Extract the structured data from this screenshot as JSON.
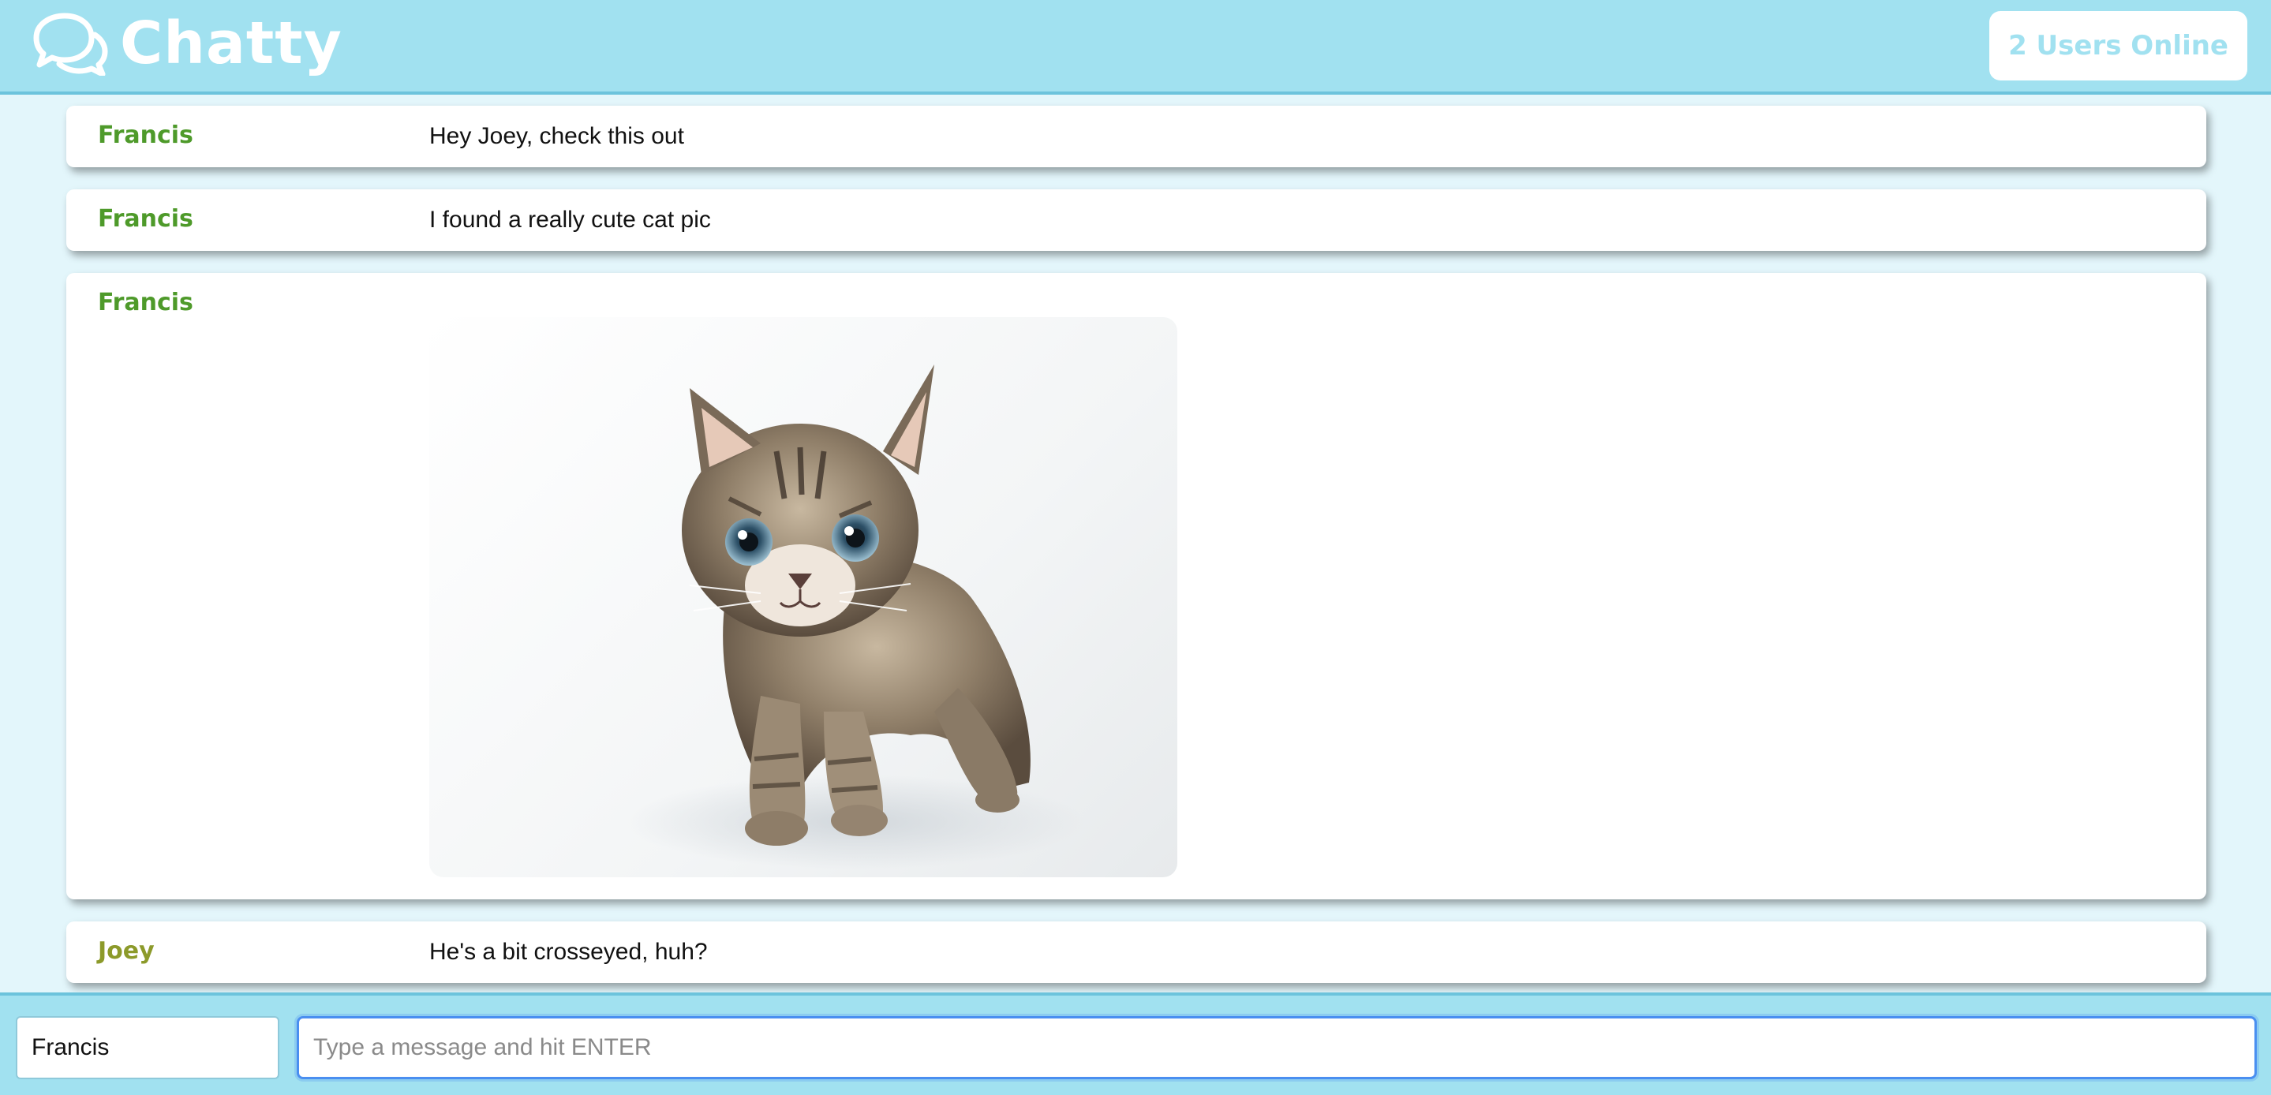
{
  "navbar": {
    "brand": "Chatty",
    "brand_icon": "chat-bubbles-icon",
    "users_online": "2 Users Online"
  },
  "messages": [
    {
      "username": "Francis",
      "color": "#4e9a2a",
      "type": "text",
      "content": "Hey Joey, check this out"
    },
    {
      "username": "Francis",
      "color": "#4e9a2a",
      "type": "text",
      "content": "I found a really cute cat pic"
    },
    {
      "username": "Francis",
      "color": "#4e9a2a",
      "type": "image",
      "image": "kitten-photo"
    },
    {
      "username": "Joey",
      "color": "#8c9a2a",
      "type": "text",
      "content": "He's a bit crosseyed, huh?"
    }
  ],
  "chatbar": {
    "username_value": "Francis",
    "message_placeholder": "Type a message and hit ENTER",
    "message_value": ""
  },
  "colors": {
    "navbar_bg": "#a1e1f0",
    "page_bg": "#e3f6fb",
    "input_focus": "#4a8ff0"
  }
}
